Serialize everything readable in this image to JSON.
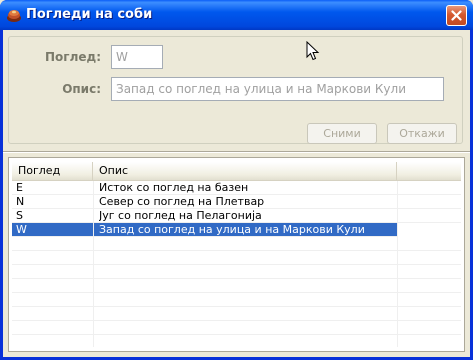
{
  "window": {
    "title": "Погледи на соби"
  },
  "form": {
    "view_label": "Поглед:",
    "view_value": "W",
    "desc_label": "Опис:",
    "desc_value": "Запад со поглед на улица и на Маркови Кули"
  },
  "buttons": {
    "save_label": "Сними",
    "cancel_label": "Откажи"
  },
  "grid": {
    "columns": [
      "Поглед",
      "Опис"
    ],
    "rows": [
      {
        "code": "E",
        "desc": "Исток со поглед на базен"
      },
      {
        "code": "N",
        "desc": "Север со поглед на Плетвар"
      },
      {
        "code": "S",
        "desc": "Југ со поглед на Пелагонија"
      },
      {
        "code": "W",
        "desc": "Запад со поглед на улица и на Маркови Кули"
      }
    ],
    "selected_index": 3
  },
  "colors": {
    "titlebar": "#0058EE",
    "selection": "#316AC5",
    "close_button": "#D5582F"
  },
  "icons": [
    "app-icon",
    "close-icon",
    "mouse-cursor-icon"
  ]
}
